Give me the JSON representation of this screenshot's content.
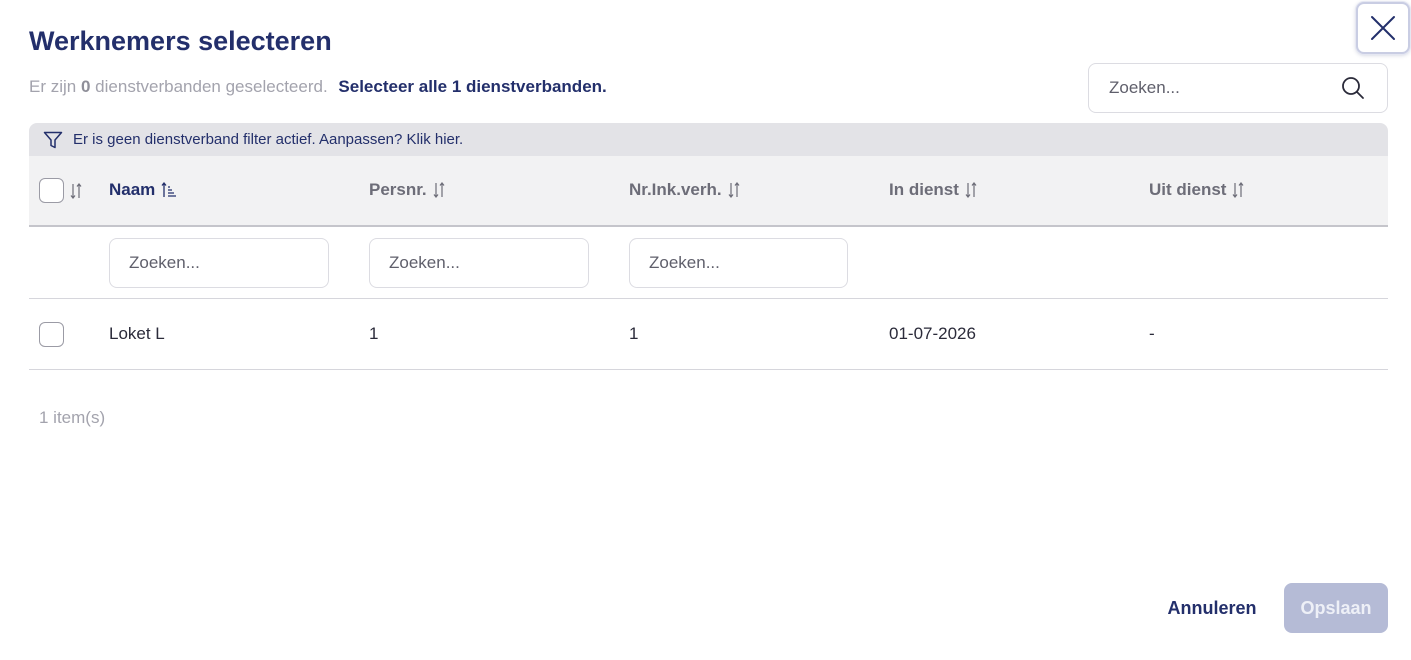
{
  "dialog": {
    "title": "Werknemers selecteren",
    "close_icon": "close-icon"
  },
  "selection": {
    "prefix": "Er zijn",
    "count": "0",
    "suffix": "dienstverbanden geselecteerd.",
    "select_all": "Selecteer alle 1 dienstverbanden."
  },
  "search": {
    "placeholder": "Zoeken...",
    "icon": "search-icon"
  },
  "filter_bar": {
    "text": "Er is geen dienstverband filter actief. Aanpassen? Klik hier.",
    "icon": "filter-icon"
  },
  "table": {
    "columns": [
      {
        "label": "Naam",
        "sort": "ascending"
      },
      {
        "label": "Persnr.",
        "sort": "none"
      },
      {
        "label": "Nr.Ink.verh.",
        "sort": "none"
      },
      {
        "label": "In dienst",
        "sort": "none"
      },
      {
        "label": "Uit dienst",
        "sort": "none"
      }
    ],
    "filter_placeholders": [
      "Zoeken...",
      "Zoeken...",
      "Zoeken..."
    ],
    "rows": [
      {
        "cells": [
          "Loket L",
          "1",
          "1",
          "01-07-2026",
          "-"
        ],
        "selected": false
      }
    ]
  },
  "footer": {
    "item_count": "1 item(s)",
    "cancel_label": "Annuleren",
    "save_label": "Opslaan"
  },
  "colors": {
    "primary": "#232f6b",
    "muted_text": "#a3a3ad",
    "header_bg": "#f2f2f3",
    "filter_bar_bg": "#e3e3e7",
    "save_disabled_bg": "#b5bbd6"
  }
}
